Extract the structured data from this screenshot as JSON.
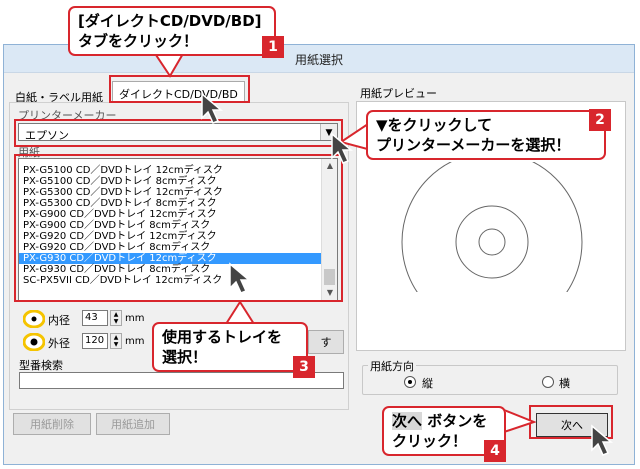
{
  "window": {
    "title": "用紙選択"
  },
  "tabs": [
    {
      "label": "白紙・ラベル用紙"
    },
    {
      "label": "ダイレクトCD/DVD/BD"
    }
  ],
  "maker": {
    "label": "プリンターメーカー",
    "value": "エプソン"
  },
  "list": {
    "label": "用紙",
    "items": [
      "PX-G5100 CD／DVDトレイ 12cmディスク",
      "PX-G5100 CD／DVDトレイ 8cmディスク",
      "PX-G5300 CD／DVDトレイ 12cmディスク",
      "PX-G5300 CD／DVDトレイ 8cmディスク",
      "PX-G900 CD／DVDトレイ 12cmディスク",
      "PX-G900 CD／DVDトレイ 8cmディスク",
      "PX-G920 CD／DVDトレイ 12cmディスク",
      "PX-G920 CD／DVDトレイ 8cmディスク",
      "PX-G930 CD／DVDトレイ 12cmディスク",
      "PX-G930 CD／DVDトレイ 8cmディスク",
      "SC-PX5VII CD／DVDトレイ 12cmディスク"
    ],
    "selected_index": 8
  },
  "inner": {
    "label": "内径",
    "value": "43",
    "unit": "mm"
  },
  "outer": {
    "label": "外径",
    "value": "120",
    "unit": "mm"
  },
  "settings_btn_label": "す",
  "search": {
    "label": "型番検索",
    "value": ""
  },
  "buttons": {
    "delete": "用紙削除",
    "add": "用紙追加",
    "next": "次へ"
  },
  "preview": {
    "label": "用紙プレビュー"
  },
  "orientation": {
    "label": "用紙方向",
    "portrait": "縦",
    "landscape": "横",
    "selected": "portrait"
  },
  "callouts": {
    "c1_line1": "[ダイレクトCD/DVD/BD]",
    "c1_line2": "タブをクリック！",
    "c1_num": "1",
    "c2_line1": "▼をクリックして",
    "c2_line2": "プリンターメーカーを選択！",
    "c2_num": "2",
    "c3_line1": "使用するトレイを",
    "c3_line2": "選択！",
    "c3_num": "3",
    "c4_hl": "次へ",
    "c4_line1": " ボタンを",
    "c4_line2": "クリック！",
    "c4_num": "4"
  },
  "colors": {
    "accent_red": "#d8262d",
    "selection": "#3399ff",
    "radio_yellow": "#f5c400"
  }
}
